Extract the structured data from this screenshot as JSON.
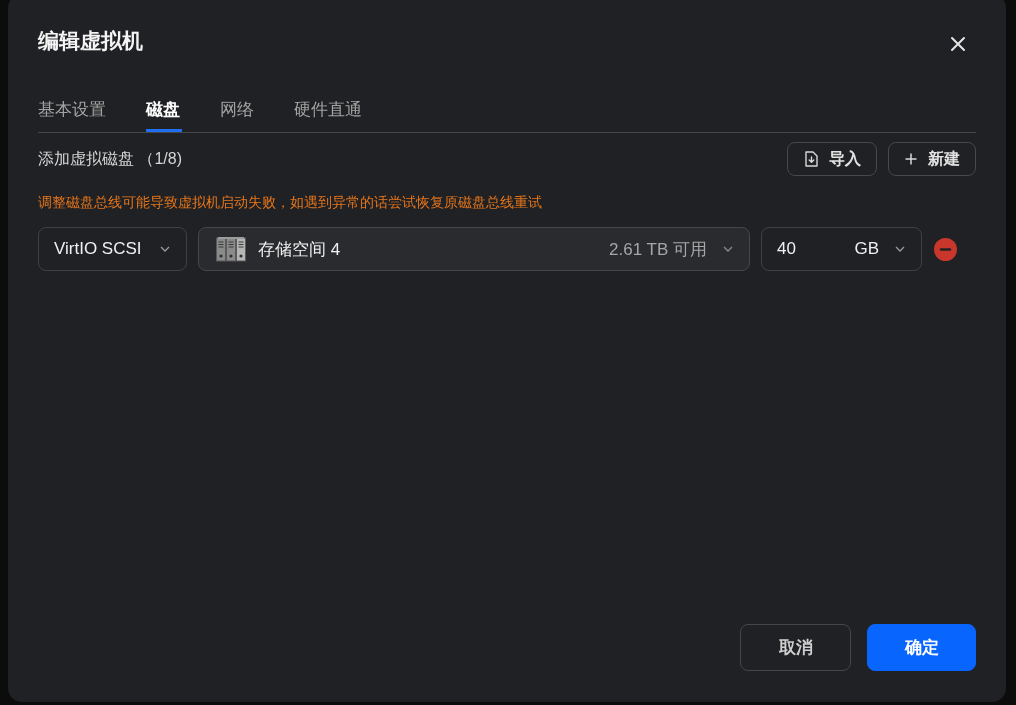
{
  "dialog": {
    "title": "编辑虚拟机"
  },
  "tabs": [
    {
      "label": "基本设置",
      "selected": false
    },
    {
      "label": "磁盘",
      "selected": true
    },
    {
      "label": "网络",
      "selected": false
    },
    {
      "label": "硬件直通",
      "selected": false
    }
  ],
  "disk_section": {
    "heading": "添加虚拟磁盘 （1/8)",
    "actions": [
      {
        "kind": "import",
        "label": "导入"
      },
      {
        "kind": "new",
        "label": "新建"
      }
    ],
    "warning": "调整磁盘总线可能导致虚拟机启动失败，如遇到异常的话尝试恢复原磁盘总线重试",
    "disks": [
      {
        "bus": "VirtIO SCSI",
        "storage": "存储空间 4",
        "available": "2.61 TB 可用",
        "size": "40",
        "unit": "GB"
      }
    ]
  },
  "footer_buttons": [
    {
      "kind": "secondary",
      "label": "取消"
    },
    {
      "kind": "primary",
      "label": "确定"
    }
  ]
}
